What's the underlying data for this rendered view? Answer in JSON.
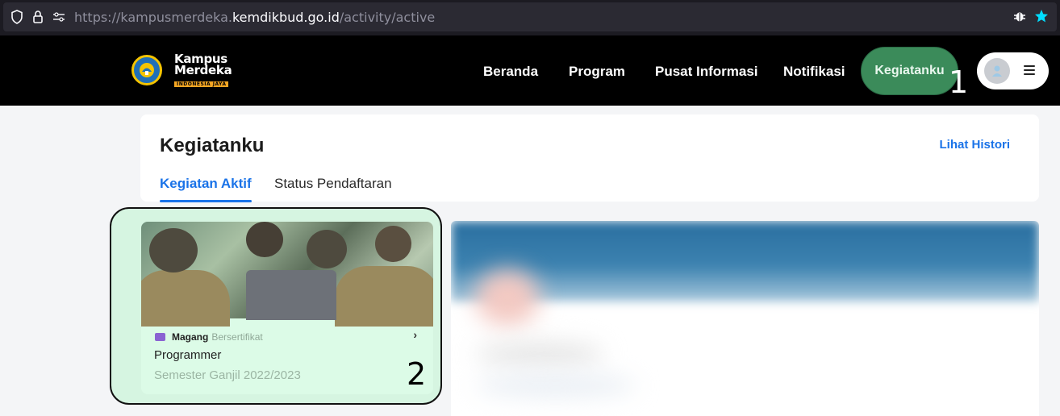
{
  "browser": {
    "url_prefix": "https://kampusmerdeka.",
    "url_domain": "kemdikbud.go.id",
    "url_path": "/activity/active",
    "icons": [
      "shield-icon",
      "lock-icon",
      "permissions-icon",
      "bug-icon",
      "star-icon"
    ]
  },
  "header": {
    "logo_line1": "Kampus",
    "logo_line2": "Merdeka",
    "logo_tag": "INDONESIA JAYA",
    "nav": {
      "home": "Beranda",
      "program": "Program",
      "info": "Pusat Informasi",
      "notif": "Notifikasi",
      "active": "Kegiatanku"
    },
    "annotation": "1"
  },
  "main": {
    "title": "Kegiatanku",
    "history_link": "Lihat Histori",
    "tabs": {
      "active": "Kegiatan Aktif",
      "inactive": "Status Pendaftaran"
    }
  },
  "activity": {
    "category": "Magang",
    "category_type": "Bersertifikat",
    "title": "Programmer",
    "subtitle": "Semester Ganjil 2022/2023",
    "annotation": "2"
  },
  "colors": {
    "accent_blue": "#1a73e8",
    "active_green": "#3b8b5a",
    "card_green": "#dcfbe7"
  }
}
